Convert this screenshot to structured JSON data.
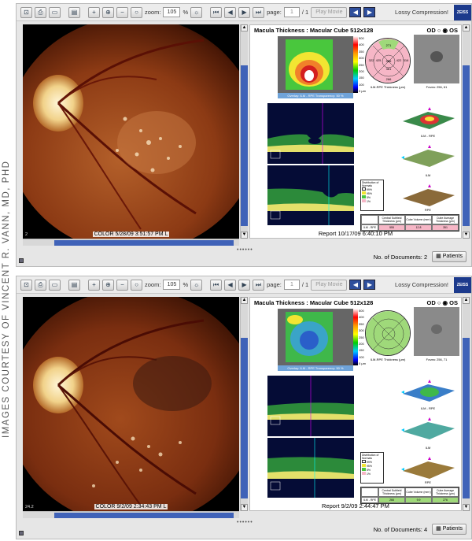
{
  "credit": "IMAGES COURTESY OF VINCENT R. VANN, MD, PHD",
  "toolbar": {
    "zoom_label": "zoom:",
    "zoom_value": "105",
    "zoom_unit": "%",
    "page_label": "page:",
    "page_sep": "/ 1",
    "play_label": "Play Movie",
    "lossy_label": "Lossy Compression!",
    "zeiss_logo": "ZEISS"
  },
  "panels": [
    {
      "fundus_label": "COLOR 5/28/09 3:51:57 PM L",
      "fundus_corner": "2",
      "page_value": "1",
      "report": {
        "title": "Macula Thickness : Macular Cube 512x128",
        "od": "OD",
        "os": "OS",
        "overlay_label": "Overlay: ILM - RPE  Transparency: 50 %",
        "etdrs_label": "ILM-RPE Thickness (μm)",
        "etdrs_values": [
          "271",
          "322",
          "425",
          "555",
          "422",
          "316",
          "361",
          "266"
        ],
        "fovea_label": "Fovea: 256, 61",
        "surfaces": [
          "ILM - RPE",
          "ILM",
          "RPE"
        ],
        "dist_title": "Distribution of Normals",
        "dist_items": [
          "99%",
          "95%",
          "5%",
          "1%"
        ],
        "table_headers": [
          "",
          "Central Subfield Thickness (μm)",
          "Cube Volume (mm³)",
          "Cube Average Thickness (μm)"
        ],
        "table_row": [
          "ILM - RPE",
          "555",
          "12.8",
          "351"
        ],
        "footer": "Report 10/17/09 6:40:10 PM"
      },
      "status": {
        "docs_label": "No. of Documents: 2",
        "patients_label": "Patients"
      }
    },
    {
      "fundus_label": "COLOR 9/2/09 2:34:43 PM L",
      "fundus_corner": "24.2",
      "page_value": "1",
      "report": {
        "title": "Macula Thickness : Macular Cube 512x128",
        "od": "OD",
        "os": "OS",
        "overlay_label": "Overlay: ILM - RPE  Transparency: 50 %",
        "etdrs_label": "ILM-RPE Thickness (μm)",
        "etdrs_values": [
          "",
          "",
          "",
          "",
          "",
          "",
          "",
          ""
        ],
        "fovea_label": "Fovea: 256, 71",
        "surfaces": [
          "ILM - RPE",
          "ILM",
          "RPE"
        ],
        "dist_title": "Distribution of Normals",
        "dist_items": [
          "99%",
          "95%",
          "5%",
          "1%"
        ],
        "table_headers": [
          "",
          "Central Subfield Thickness (μm)",
          "Cube Volume (mm³)",
          "Cube Average Thickness (μm)"
        ],
        "table_row": [
          "ILM - RPE",
          "266",
          "9.9",
          "276"
        ],
        "footer": "Report 9/2/09 2:44:47 PM"
      },
      "status": {
        "docs_label": "No. of Documents: 4",
        "patients_label": "Patients"
      }
    }
  ],
  "scale_ticks": [
    "500",
    "400",
    "350",
    "300",
    "250",
    "200",
    "150",
    "100",
    "0 μm"
  ]
}
